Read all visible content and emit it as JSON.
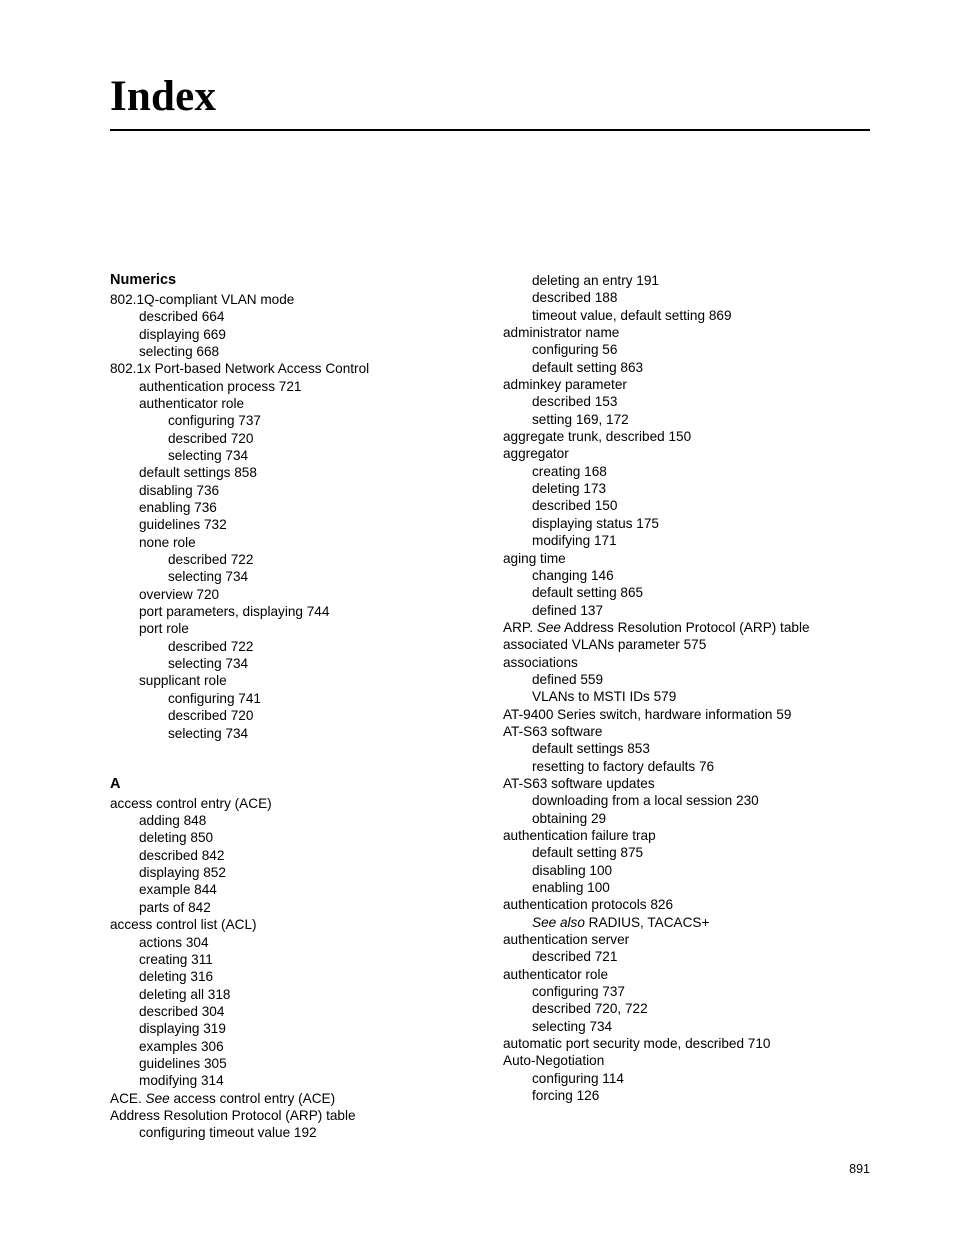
{
  "document": {
    "title": "Index",
    "folio": "891"
  },
  "columns": [
    {
      "name": "left-column",
      "blocks": [
        {
          "heading": "Numerics",
          "spaced": false,
          "entries": [
            {
              "level": 0,
              "text": "802.1Q-compliant VLAN mode"
            },
            {
              "level": 1,
              "text": "described 664"
            },
            {
              "level": 1,
              "text": "displaying 669"
            },
            {
              "level": 1,
              "text": "selecting 668"
            },
            {
              "level": 0,
              "text": "802.1x Port-based Network Access Control"
            },
            {
              "level": 1,
              "text": "authentication process 721"
            },
            {
              "level": 1,
              "text": "authenticator role"
            },
            {
              "level": 2,
              "text": "configuring 737"
            },
            {
              "level": 2,
              "text": "described 720"
            },
            {
              "level": 2,
              "text": "selecting 734"
            },
            {
              "level": 1,
              "text": "default settings 858"
            },
            {
              "level": 1,
              "text": "disabling 736"
            },
            {
              "level": 1,
              "text": "enabling 736"
            },
            {
              "level": 1,
              "text": "guidelines 732"
            },
            {
              "level": 1,
              "text": "none role"
            },
            {
              "level": 2,
              "text": "described 722"
            },
            {
              "level": 2,
              "text": "selecting 734"
            },
            {
              "level": 1,
              "text": "overview 720"
            },
            {
              "level": 1,
              "text": "port parameters, displaying 744"
            },
            {
              "level": 1,
              "text": "port role"
            },
            {
              "level": 2,
              "text": "described 722"
            },
            {
              "level": 2,
              "text": "selecting 734"
            },
            {
              "level": 1,
              "text": "supplicant role"
            },
            {
              "level": 2,
              "text": "configuring 741"
            },
            {
              "level": 2,
              "text": "described 720"
            },
            {
              "level": 2,
              "text": "selecting 734"
            }
          ]
        },
        {
          "heading": "A",
          "spaced": true,
          "entries": [
            {
              "level": 0,
              "text": "access control entry (ACE)"
            },
            {
              "level": 1,
              "text": "adding 848"
            },
            {
              "level": 1,
              "text": "deleting 850"
            },
            {
              "level": 1,
              "text": "described 842"
            },
            {
              "level": 1,
              "text": "displaying 852"
            },
            {
              "level": 1,
              "text": "example 844"
            },
            {
              "level": 1,
              "text": "parts of 842"
            },
            {
              "level": 0,
              "text": "access control list (ACL)"
            },
            {
              "level": 1,
              "text": "actions 304"
            },
            {
              "level": 1,
              "text": "creating 311"
            },
            {
              "level": 1,
              "text": "deleting 316"
            },
            {
              "level": 1,
              "text": "deleting all 318"
            },
            {
              "level": 1,
              "text": "described 304"
            },
            {
              "level": 1,
              "text": "displaying 319"
            },
            {
              "level": 1,
              "text": "examples 306"
            },
            {
              "level": 1,
              "text": "guidelines 305"
            },
            {
              "level": 1,
              "text": "modifying 314"
            },
            {
              "level": 0,
              "prefix": "ACE. ",
              "italic": "See",
              "suffix": " access control entry (ACE)"
            },
            {
              "level": 0,
              "text": "Address Resolution Protocol (ARP) table"
            },
            {
              "level": 1,
              "text": "configuring timeout value 192"
            }
          ]
        }
      ]
    },
    {
      "name": "right-column",
      "blocks": [
        {
          "heading": null,
          "spaced": false,
          "entries": [
            {
              "level": 1,
              "text": "deleting an entry 191"
            },
            {
              "level": 1,
              "text": "described 188"
            },
            {
              "level": 1,
              "text": "timeout value, default setting 869"
            },
            {
              "level": 0,
              "text": "administrator name"
            },
            {
              "level": 1,
              "text": "configuring 56"
            },
            {
              "level": 1,
              "text": "default setting 863"
            },
            {
              "level": 0,
              "text": "adminkey parameter"
            },
            {
              "level": 1,
              "text": "described 153"
            },
            {
              "level": 1,
              "text": "setting 169, 172"
            },
            {
              "level": 0,
              "text": "aggregate trunk, described 150"
            },
            {
              "level": 0,
              "text": "aggregator"
            },
            {
              "level": 1,
              "text": "creating 168"
            },
            {
              "level": 1,
              "text": "deleting 173"
            },
            {
              "level": 1,
              "text": "described 150"
            },
            {
              "level": 1,
              "text": "displaying status 175"
            },
            {
              "level": 1,
              "text": "modifying 171"
            },
            {
              "level": 0,
              "text": "aging time"
            },
            {
              "level": 1,
              "text": "changing 146"
            },
            {
              "level": 1,
              "text": "default setting 865"
            },
            {
              "level": 1,
              "text": "defined 137"
            },
            {
              "level": 0,
              "prefix": "ARP. ",
              "italic": "See",
              "suffix": " Address Resolution Protocol (ARP) table"
            },
            {
              "level": 0,
              "text": "associated VLANs parameter 575"
            },
            {
              "level": 0,
              "text": "associations"
            },
            {
              "level": 1,
              "text": "defined 559"
            },
            {
              "level": 1,
              "text": "VLANs to MSTI IDs 579"
            },
            {
              "level": 0,
              "text": "AT-9400 Series switch, hardware information 59"
            },
            {
              "level": 0,
              "text": "AT-S63 software"
            },
            {
              "level": 1,
              "text": "default settings 853"
            },
            {
              "level": 1,
              "text": "resetting to factory defaults 76"
            },
            {
              "level": 0,
              "text": "AT-S63 software updates"
            },
            {
              "level": 1,
              "text": "downloading from a local session 230"
            },
            {
              "level": 1,
              "text": "obtaining 29"
            },
            {
              "level": 0,
              "text": "authentication failure trap"
            },
            {
              "level": 1,
              "text": "default setting 875"
            },
            {
              "level": 1,
              "text": "disabling 100"
            },
            {
              "level": 1,
              "text": "enabling 100"
            },
            {
              "level": 0,
              "text": "authentication protocols 826"
            },
            {
              "level": 1,
              "prefix": "",
              "italic": "See also",
              "suffix": " RADIUS, TACACS+"
            },
            {
              "level": 0,
              "text": "authentication server"
            },
            {
              "level": 1,
              "text": "described 721"
            },
            {
              "level": 0,
              "text": "authenticator role"
            },
            {
              "level": 1,
              "text": "configuring 737"
            },
            {
              "level": 1,
              "text": "described 720, 722"
            },
            {
              "level": 1,
              "text": "selecting 734"
            },
            {
              "level": 0,
              "text": "automatic port security mode, described 710"
            },
            {
              "level": 0,
              "text": "Auto-Negotiation"
            },
            {
              "level": 1,
              "text": "configuring 114"
            },
            {
              "level": 1,
              "text": "forcing 126"
            }
          ]
        }
      ]
    }
  ]
}
